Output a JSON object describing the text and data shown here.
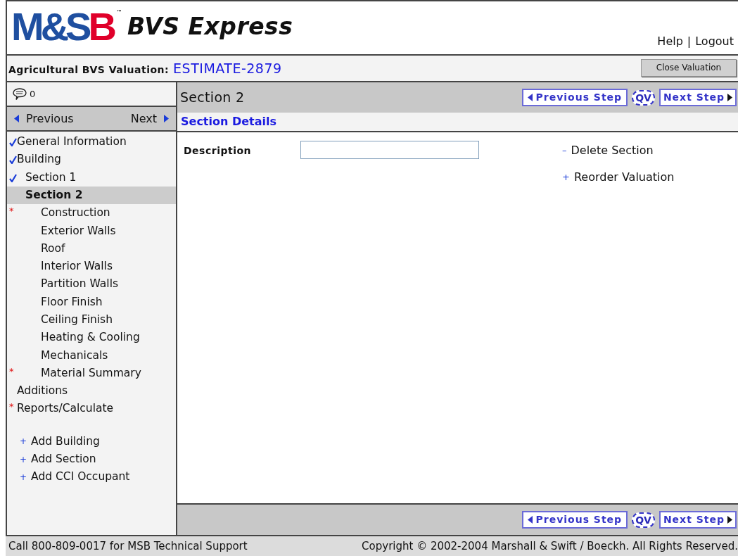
{
  "header": {
    "logo": [
      {
        "text": "M&S",
        "color": "#1f4fa0"
      },
      {
        "text": "B",
        "color": "#e0002a"
      }
    ],
    "logo_mark": "™",
    "product": "BVS Express",
    "links": [
      "Help",
      "|",
      "Logout"
    ]
  },
  "valuation_bar": {
    "label": "Agricultural BVS Valuation:",
    "estimate": "ESTIMATE-2879",
    "close_button": "Close Valuation"
  },
  "sidebar": {
    "comments_count": "0",
    "previous": "Previous",
    "next": "Next",
    "tree": [
      {
        "label": "General Information",
        "checked": true,
        "required": false,
        "selected": false
      },
      {
        "label": "Building",
        "checked": true,
        "required": false,
        "selected": false,
        "children": [
          {
            "label": "Section 1",
            "checked": true,
            "required": false,
            "selected": false
          },
          {
            "label": "Section 2",
            "checked": false,
            "required": false,
            "selected": true,
            "children": [
              {
                "label": "Construction",
                "checked": false,
                "required": true,
                "selected": false
              },
              {
                "label": "Exterior Walls",
                "checked": false,
                "required": false,
                "selected": false
              },
              {
                "label": "Roof",
                "checked": false,
                "required": false,
                "selected": false
              },
              {
                "label": "Interior Walls",
                "checked": false,
                "required": false,
                "selected": false
              },
              {
                "label": "Partition Walls",
                "checked": false,
                "required": false,
                "selected": false
              },
              {
                "label": "Floor Finish",
                "checked": false,
                "required": false,
                "selected": false
              },
              {
                "label": "Ceiling Finish",
                "checked": false,
                "required": false,
                "selected": false
              },
              {
                "label": "Heating & Cooling",
                "checked": false,
                "required": false,
                "selected": false
              },
              {
                "label": "Mechanicals",
                "checked": false,
                "required": false,
                "selected": false
              },
              {
                "label": "Material Summary",
                "checked": false,
                "required": true,
                "selected": false
              }
            ]
          }
        ]
      },
      {
        "label": "Additions",
        "checked": false,
        "required": false,
        "selected": false
      },
      {
        "label": "Reports/Calculate",
        "checked": false,
        "required": true,
        "selected": false
      }
    ],
    "required_mark": "*",
    "actions": [
      {
        "sign": "+",
        "label": "Add Building"
      },
      {
        "sign": "+",
        "label": "Add Section"
      },
      {
        "sign": "+",
        "label": "Add CCI Occupant"
      }
    ]
  },
  "main": {
    "title": "Section 2",
    "subtitle": "Section Details",
    "top_nav": {
      "previous": "Previous Step",
      "qv": "QV",
      "next": "Next Step"
    },
    "form": {
      "label": "Description"
    },
    "actions": [
      {
        "sign": "–",
        "label": "Delete Section"
      },
      {
        "sign": "+",
        "label": "Reorder Valuation"
      }
    ],
    "bottom_nav": {
      "previous": "Previous Step",
      "qv": "QV",
      "next": "Next Step"
    }
  },
  "footer": {
    "support": "Call 800-809-0017 for MSB Technical Support",
    "copyright": "Copyright © 2002-2004 Marshall & Swift / Boeckh. All Rights Reserved."
  }
}
